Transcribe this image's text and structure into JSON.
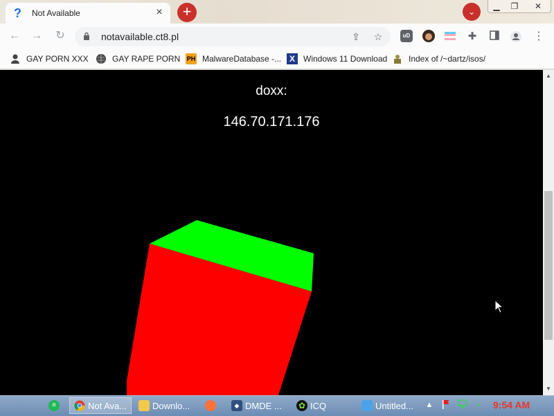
{
  "browser": {
    "tab": {
      "title": "Not Available",
      "favicon": "question-mark-icon"
    },
    "new_tab_icon": "plus-icon",
    "tab_search_icon": "chevron-down-icon",
    "address": {
      "url": "notavailable.ct8.pl"
    },
    "colors": {
      "accent_red": "#c9302c",
      "toolbar_bg": "#fbfbfb"
    }
  },
  "bookmarks": [
    {
      "label": "GAY PORN XXX",
      "icon": "puzzle-person-icon"
    },
    {
      "label": "GAY RAPE PORN",
      "icon": "globe-icon"
    },
    {
      "label": "MalwareDatabase -...",
      "icon": "ph-logo-icon"
    },
    {
      "label": "Windows 11 Download",
      "icon": "x-logo-icon"
    },
    {
      "label": "Index of /~dartz/isos/",
      "icon": "folder-person-icon"
    }
  ],
  "page": {
    "heading": "doxx:",
    "ip": "146.70.171.176",
    "colors": {
      "background": "#000000",
      "cube_top": "#00ff00",
      "cube_front": "#ff0000"
    }
  },
  "taskbar": {
    "items": [
      {
        "label": "Not Ava...",
        "icon": "chrome-icon",
        "active": true
      },
      {
        "label": "Downlo...",
        "icon": "folder-icon",
        "active": false
      },
      {
        "label": "",
        "icon": "firefox-icon",
        "active": false
      },
      {
        "label": "DMDE ...",
        "icon": "dmde-icon",
        "active": false
      },
      {
        "label": "ICQ",
        "icon": "icq-flower-icon",
        "active": false
      },
      {
        "label": "Untitled...",
        "icon": "paint-icon",
        "active": false
      }
    ],
    "clock": "9:54 AM"
  }
}
